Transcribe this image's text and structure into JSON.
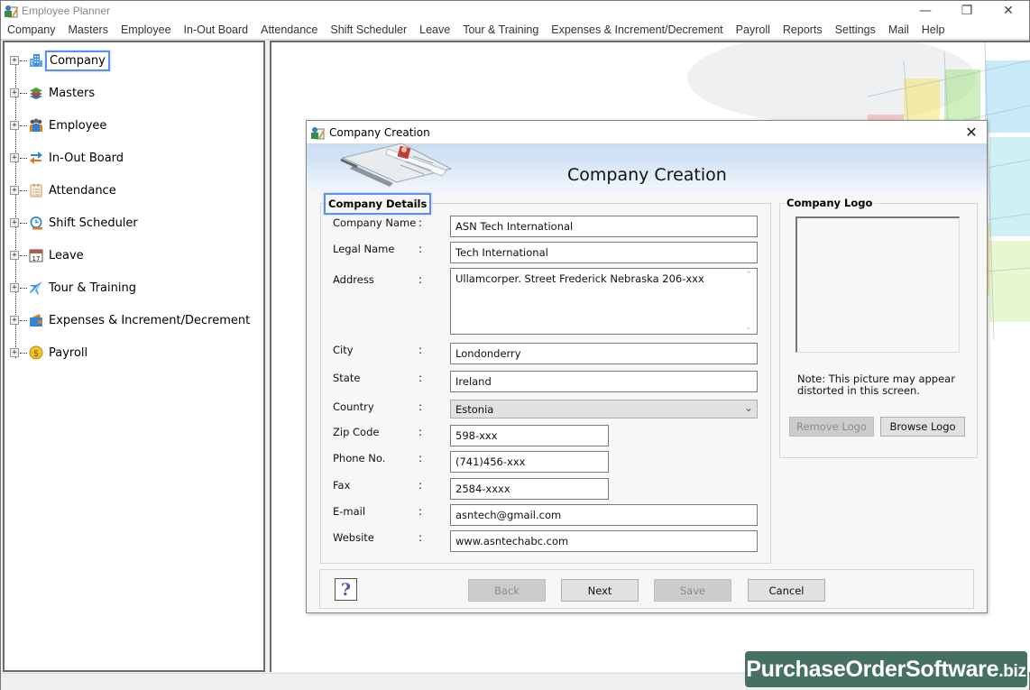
{
  "app": {
    "title": "Employee Planner",
    "window_controls": {
      "minimize": "—",
      "restore": "❐",
      "close": "✕"
    }
  },
  "menubar": {
    "items": [
      "Company",
      "Masters",
      "Employee",
      "In-Out Board",
      "Attendance",
      "Shift Scheduler",
      "Leave",
      "Tour & Training",
      "Expenses & Increment/Decrement",
      "Payroll",
      "Reports",
      "Settings",
      "Mail",
      "Help"
    ]
  },
  "tree": {
    "expander": "+",
    "items": [
      {
        "label": "Company",
        "icon": "building-icon",
        "selected": true
      },
      {
        "label": "Masters",
        "icon": "layers-icon",
        "selected": false
      },
      {
        "label": "Employee",
        "icon": "people-icon",
        "selected": false
      },
      {
        "label": "In-Out Board",
        "icon": "swap-arrows-icon",
        "selected": false
      },
      {
        "label": "Attendance",
        "icon": "clipboard-icon",
        "selected": false
      },
      {
        "label": "Shift Scheduler",
        "icon": "clock-icon",
        "selected": false
      },
      {
        "label": "Leave",
        "icon": "calendar-icon",
        "selected": false,
        "icon_text": "17"
      },
      {
        "label": "Tour & Training",
        "icon": "airplane-icon",
        "selected": false
      },
      {
        "label": "Expenses & Increment/Decrement",
        "icon": "wallet-icon",
        "selected": false
      },
      {
        "label": "Payroll",
        "icon": "dollar-coin-icon",
        "selected": false,
        "icon_text": "$"
      }
    ]
  },
  "dialog": {
    "title": "Company Creation",
    "close": "✕",
    "banner_title": "Company Creation",
    "details_legend": "Company Details",
    "fields": {
      "company_name": {
        "label": "Company Name",
        "colon": ":",
        "value": "ASN Tech International"
      },
      "legal_name": {
        "label": "Legal Name",
        "colon": ":",
        "value": "Tech International"
      },
      "address": {
        "label": "Address",
        "colon": ":",
        "value": "Ullamcorper. Street Frederick Nebraska 206-xxx"
      },
      "city": {
        "label": "City",
        "colon": ":",
        "value": "Londonderry"
      },
      "state": {
        "label": "State",
        "colon": ":",
        "value": "Ireland"
      },
      "country": {
        "label": "Country",
        "colon": ":",
        "value": "Estonia"
      },
      "zip": {
        "label": "Zip Code",
        "colon": ":",
        "value": "598-xxx"
      },
      "phone": {
        "label": "Phone No.",
        "colon": ":",
        "value": "(741)456-xxx"
      },
      "fax": {
        "label": "Fax",
        "colon": ":",
        "value": "2584-xxxx"
      },
      "email": {
        "label": "E-mail",
        "colon": ":",
        "value": "asntech@gmail.com"
      },
      "website": {
        "label": "Website",
        "colon": ":",
        "value": "www.asntechabc.com"
      }
    },
    "logo": {
      "legend": "Company Logo",
      "note": "Note: This picture may appear distorted in this screen.",
      "remove_label": "Remove Logo",
      "browse_label": "Browse Logo"
    },
    "footer": {
      "help": "?",
      "back_label": "Back",
      "next_label": "Next",
      "save_label": "Save",
      "cancel_label": "Cancel"
    }
  },
  "watermark": {
    "main": "PurchaseOrderSoftware",
    "suffix": ".biz"
  },
  "colors": {
    "accent_focus": "#5b8ff0",
    "watermark_bg": "#46705f",
    "banner_blue": "#c9ddf2"
  }
}
